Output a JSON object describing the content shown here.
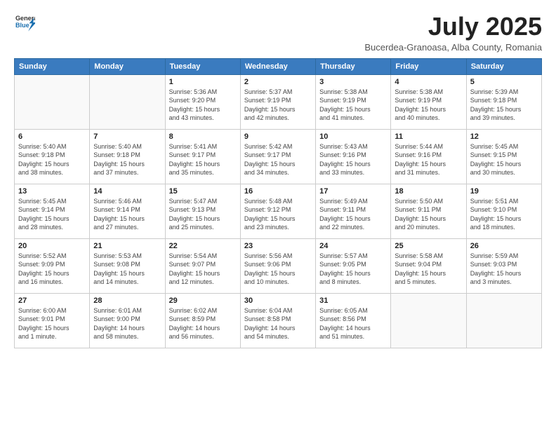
{
  "header": {
    "logo_general": "General",
    "logo_blue": "Blue",
    "title": "July 2025",
    "subtitle": "Bucerdea-Granoasa, Alba County, Romania"
  },
  "weekdays": [
    "Sunday",
    "Monday",
    "Tuesday",
    "Wednesday",
    "Thursday",
    "Friday",
    "Saturday"
  ],
  "weeks": [
    [
      {
        "day": "",
        "info": ""
      },
      {
        "day": "",
        "info": ""
      },
      {
        "day": "1",
        "info": "Sunrise: 5:36 AM\nSunset: 9:20 PM\nDaylight: 15 hours\nand 43 minutes."
      },
      {
        "day": "2",
        "info": "Sunrise: 5:37 AM\nSunset: 9:19 PM\nDaylight: 15 hours\nand 42 minutes."
      },
      {
        "day": "3",
        "info": "Sunrise: 5:38 AM\nSunset: 9:19 PM\nDaylight: 15 hours\nand 41 minutes."
      },
      {
        "day": "4",
        "info": "Sunrise: 5:38 AM\nSunset: 9:19 PM\nDaylight: 15 hours\nand 40 minutes."
      },
      {
        "day": "5",
        "info": "Sunrise: 5:39 AM\nSunset: 9:18 PM\nDaylight: 15 hours\nand 39 minutes."
      }
    ],
    [
      {
        "day": "6",
        "info": "Sunrise: 5:40 AM\nSunset: 9:18 PM\nDaylight: 15 hours\nand 38 minutes."
      },
      {
        "day": "7",
        "info": "Sunrise: 5:40 AM\nSunset: 9:18 PM\nDaylight: 15 hours\nand 37 minutes."
      },
      {
        "day": "8",
        "info": "Sunrise: 5:41 AM\nSunset: 9:17 PM\nDaylight: 15 hours\nand 35 minutes."
      },
      {
        "day": "9",
        "info": "Sunrise: 5:42 AM\nSunset: 9:17 PM\nDaylight: 15 hours\nand 34 minutes."
      },
      {
        "day": "10",
        "info": "Sunrise: 5:43 AM\nSunset: 9:16 PM\nDaylight: 15 hours\nand 33 minutes."
      },
      {
        "day": "11",
        "info": "Sunrise: 5:44 AM\nSunset: 9:16 PM\nDaylight: 15 hours\nand 31 minutes."
      },
      {
        "day": "12",
        "info": "Sunrise: 5:45 AM\nSunset: 9:15 PM\nDaylight: 15 hours\nand 30 minutes."
      }
    ],
    [
      {
        "day": "13",
        "info": "Sunrise: 5:45 AM\nSunset: 9:14 PM\nDaylight: 15 hours\nand 28 minutes."
      },
      {
        "day": "14",
        "info": "Sunrise: 5:46 AM\nSunset: 9:14 PM\nDaylight: 15 hours\nand 27 minutes."
      },
      {
        "day": "15",
        "info": "Sunrise: 5:47 AM\nSunset: 9:13 PM\nDaylight: 15 hours\nand 25 minutes."
      },
      {
        "day": "16",
        "info": "Sunrise: 5:48 AM\nSunset: 9:12 PM\nDaylight: 15 hours\nand 23 minutes."
      },
      {
        "day": "17",
        "info": "Sunrise: 5:49 AM\nSunset: 9:11 PM\nDaylight: 15 hours\nand 22 minutes."
      },
      {
        "day": "18",
        "info": "Sunrise: 5:50 AM\nSunset: 9:11 PM\nDaylight: 15 hours\nand 20 minutes."
      },
      {
        "day": "19",
        "info": "Sunrise: 5:51 AM\nSunset: 9:10 PM\nDaylight: 15 hours\nand 18 minutes."
      }
    ],
    [
      {
        "day": "20",
        "info": "Sunrise: 5:52 AM\nSunset: 9:09 PM\nDaylight: 15 hours\nand 16 minutes."
      },
      {
        "day": "21",
        "info": "Sunrise: 5:53 AM\nSunset: 9:08 PM\nDaylight: 15 hours\nand 14 minutes."
      },
      {
        "day": "22",
        "info": "Sunrise: 5:54 AM\nSunset: 9:07 PM\nDaylight: 15 hours\nand 12 minutes."
      },
      {
        "day": "23",
        "info": "Sunrise: 5:56 AM\nSunset: 9:06 PM\nDaylight: 15 hours\nand 10 minutes."
      },
      {
        "day": "24",
        "info": "Sunrise: 5:57 AM\nSunset: 9:05 PM\nDaylight: 15 hours\nand 8 minutes."
      },
      {
        "day": "25",
        "info": "Sunrise: 5:58 AM\nSunset: 9:04 PM\nDaylight: 15 hours\nand 5 minutes."
      },
      {
        "day": "26",
        "info": "Sunrise: 5:59 AM\nSunset: 9:03 PM\nDaylight: 15 hours\nand 3 minutes."
      }
    ],
    [
      {
        "day": "27",
        "info": "Sunrise: 6:00 AM\nSunset: 9:01 PM\nDaylight: 15 hours\nand 1 minute."
      },
      {
        "day": "28",
        "info": "Sunrise: 6:01 AM\nSunset: 9:00 PM\nDaylight: 14 hours\nand 58 minutes."
      },
      {
        "day": "29",
        "info": "Sunrise: 6:02 AM\nSunset: 8:59 PM\nDaylight: 14 hours\nand 56 minutes."
      },
      {
        "day": "30",
        "info": "Sunrise: 6:04 AM\nSunset: 8:58 PM\nDaylight: 14 hours\nand 54 minutes."
      },
      {
        "day": "31",
        "info": "Sunrise: 6:05 AM\nSunset: 8:56 PM\nDaylight: 14 hours\nand 51 minutes."
      },
      {
        "day": "",
        "info": ""
      },
      {
        "day": "",
        "info": ""
      }
    ]
  ]
}
